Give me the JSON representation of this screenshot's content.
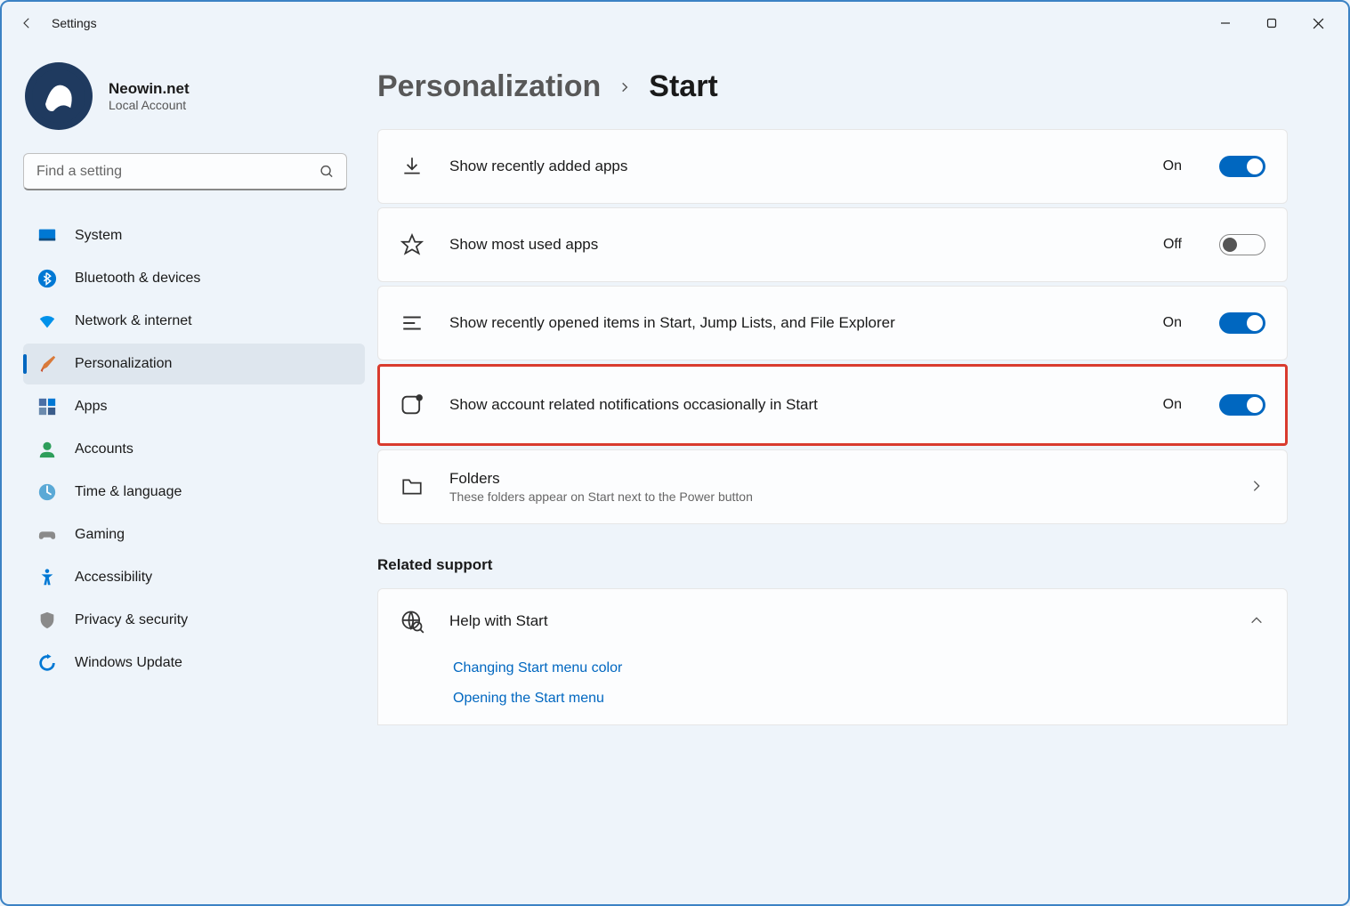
{
  "title": "Settings",
  "profile": {
    "name": "Neowin.net",
    "account": "Local Account"
  },
  "search": {
    "placeholder": "Find a setting"
  },
  "nav": {
    "items": [
      {
        "label": "System"
      },
      {
        "label": "Bluetooth & devices"
      },
      {
        "label": "Network & internet"
      },
      {
        "label": "Personalization"
      },
      {
        "label": "Apps"
      },
      {
        "label": "Accounts"
      },
      {
        "label": "Time & language"
      },
      {
        "label": "Gaming"
      },
      {
        "label": "Accessibility"
      },
      {
        "label": "Privacy & security"
      },
      {
        "label": "Windows Update"
      }
    ]
  },
  "breadcrumb": {
    "parent": "Personalization",
    "current": "Start"
  },
  "settings": [
    {
      "label": "Show recently added apps",
      "state": "On",
      "on": true
    },
    {
      "label": "Show most used apps",
      "state": "Off",
      "on": false
    },
    {
      "label": "Show recently opened items in Start, Jump Lists, and File Explorer",
      "state": "On",
      "on": true
    },
    {
      "label": "Show account related notifications occasionally in Start",
      "state": "On",
      "on": true
    }
  ],
  "folders": {
    "title": "Folders",
    "sub": "These folders appear on Start next to the Power button"
  },
  "related": {
    "title": "Related support"
  },
  "help": {
    "title": "Help with Start",
    "links": [
      "Changing Start menu color",
      "Opening the Start menu"
    ]
  }
}
